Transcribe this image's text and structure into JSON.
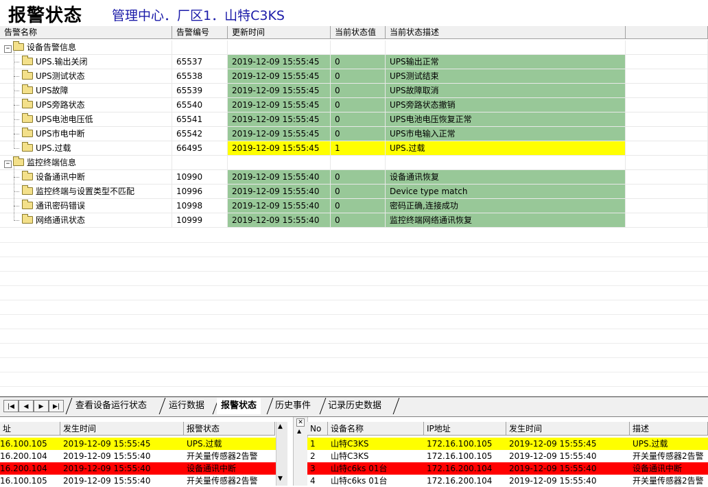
{
  "header": {
    "title": "报警状态",
    "path": "管理中心．厂区1．山特C3KS"
  },
  "grid": {
    "columns": [
      "告警名称",
      "告警编号",
      "更新时间",
      "当前状态值",
      "当前状态描述"
    ],
    "groups": [
      {
        "name": "设备告警信息",
        "toggle": "−",
        "rows": [
          {
            "name": "UPS.输出关闭",
            "id": "65537",
            "time": "2019-12-09 15:55:45",
            "value": "0",
            "desc": "UPS输出正常",
            "status": "green"
          },
          {
            "name": "UPS测试状态",
            "id": "65538",
            "time": "2019-12-09 15:55:45",
            "value": "0",
            "desc": "UPS测试结束",
            "status": "green"
          },
          {
            "name": "UPS故障",
            "id": "65539",
            "time": "2019-12-09 15:55:45",
            "value": "0",
            "desc": "UPS故障取消",
            "status": "green"
          },
          {
            "name": "UPS旁路状态",
            "id": "65540",
            "time": "2019-12-09 15:55:45",
            "value": "0",
            "desc": "UPS旁路状态撤销",
            "status": "green"
          },
          {
            "name": "UPS电池电压低",
            "id": "65541",
            "time": "2019-12-09 15:55:45",
            "value": "0",
            "desc": "UPS电池电压恢复正常",
            "status": "green"
          },
          {
            "name": "UPS市电中断",
            "id": "65542",
            "time": "2019-12-09 15:55:45",
            "value": "0",
            "desc": "UPS市电输入正常",
            "status": "green"
          },
          {
            "name": "UPS.过载",
            "id": "66495",
            "time": "2019-12-09 15:55:45",
            "value": "1",
            "desc": "UPS.过载",
            "status": "yellow"
          }
        ]
      },
      {
        "name": "监控终端信息",
        "toggle": "−",
        "rows": [
          {
            "name": "设备通讯中断",
            "id": "10990",
            "time": "2019-12-09 15:55:40",
            "value": "0",
            "desc": "设备通讯恢复",
            "status": "green"
          },
          {
            "name": "监控终端与设置类型不匹配",
            "id": "10996",
            "time": "2019-12-09 15:55:40",
            "value": "0",
            "desc": "Device type match",
            "status": "green"
          },
          {
            "name": "通讯密码错误",
            "id": "10998",
            "time": "2019-12-09 15:55:40",
            "value": "0",
            "desc": "密码正确,连接成功",
            "status": "green"
          },
          {
            "name": "网络通讯状态",
            "id": "10999",
            "time": "2019-12-09 15:55:40",
            "value": "0",
            "desc": "监控终端网络通讯恢复",
            "status": "green"
          }
        ]
      }
    ]
  },
  "tabs": {
    "nav": [
      "|◀",
      "◀",
      "▶",
      "▶|"
    ],
    "items": [
      {
        "label": "查看设备运行状态",
        "active": false
      },
      {
        "label": "运行数据",
        "active": false
      },
      {
        "label": "报警状态",
        "active": true
      },
      {
        "label": "历史事件",
        "active": false
      },
      {
        "label": "记录历史数据",
        "active": false
      }
    ]
  },
  "left_panel": {
    "columns": [
      "址",
      "发生时间",
      "报警状态"
    ],
    "rows": [
      {
        "addr": "16.100.105",
        "time": "2019-12-09 15:55:45",
        "status": "UPS.过载",
        "color": "yellow"
      },
      {
        "addr": "16.200.104",
        "time": "2019-12-09 15:55:40",
        "status": "开关量传感器2告警",
        "color": "white"
      },
      {
        "addr": "16.200.104",
        "time": "2019-12-09 15:55:40",
        "status": "设备通讯中断",
        "color": "red"
      },
      {
        "addr": "16.100.105",
        "time": "2019-12-09 15:55:40",
        "status": "开关量传感器2告警",
        "color": "white"
      }
    ]
  },
  "right_panel": {
    "columns": [
      "No",
      "设备名称",
      "IP地址",
      "发生时间",
      "描述"
    ],
    "rows": [
      {
        "no": "1",
        "device": "山特C3KS",
        "ip": "172.16.100.105",
        "time": "2019-12-09 15:55:45",
        "desc": "UPS.过载",
        "color": "yellow"
      },
      {
        "no": "2",
        "device": "山特C3KS",
        "ip": "172.16.100.105",
        "time": "2019-12-09 15:55:40",
        "desc": "开关量传感器2告警",
        "color": "white"
      },
      {
        "no": "3",
        "device": "山特c6ks 01台",
        "ip": "172.16.200.104",
        "time": "2019-12-09 15:55:40",
        "desc": "设备通讯中断",
        "color": "red"
      },
      {
        "no": "4",
        "device": "山特c6ks 01台",
        "ip": "172.16.200.104",
        "time": "2019-12-09 15:55:40",
        "desc": "开关量传感器2告警",
        "color": "white"
      }
    ]
  },
  "colors": {
    "green": "#98c898",
    "yellow": "#ffff00",
    "red": "#ff0000",
    "title_path": "#1a1aa8"
  }
}
